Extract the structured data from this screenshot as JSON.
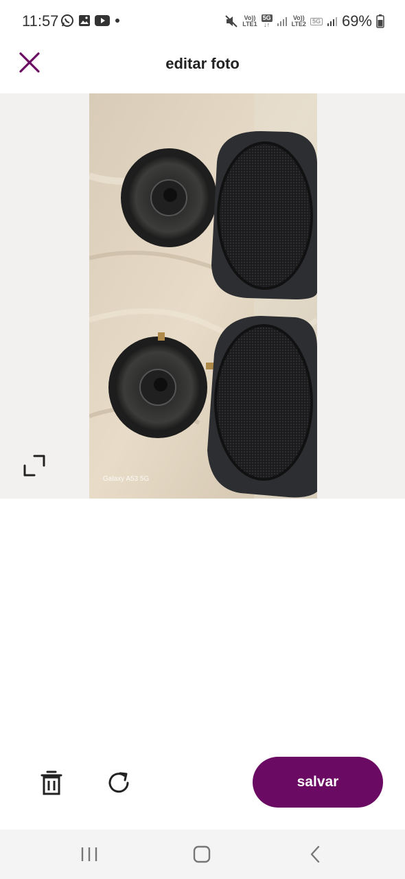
{
  "status_bar": {
    "time": "11:57",
    "notification_icons": [
      "whatsapp-icon",
      "gallery-icon",
      "youtube-icon",
      "dot-icon"
    ],
    "sim1_label_top": "Vo))",
    "sim1_label_bottom": "LTE1",
    "sim1_network": "5G",
    "sim2_label_top": "Vo))",
    "sim2_label_bottom": "LTE2",
    "sim2_network": "5G",
    "battery": "69%"
  },
  "header": {
    "title": "editar foto",
    "close_icon": "close-icon",
    "accent_color": "#6a0a63"
  },
  "photo": {
    "watermark": "Galaxy A53 5G",
    "expand_icon": "expand-icon"
  },
  "toolbar": {
    "delete_icon": "trash-icon",
    "rotate_icon": "rotate-icon",
    "save_label": "salvar",
    "save_color": "#6a0a63"
  },
  "nav_bar": {
    "items": [
      "recents-icon",
      "home-icon",
      "back-icon"
    ]
  }
}
